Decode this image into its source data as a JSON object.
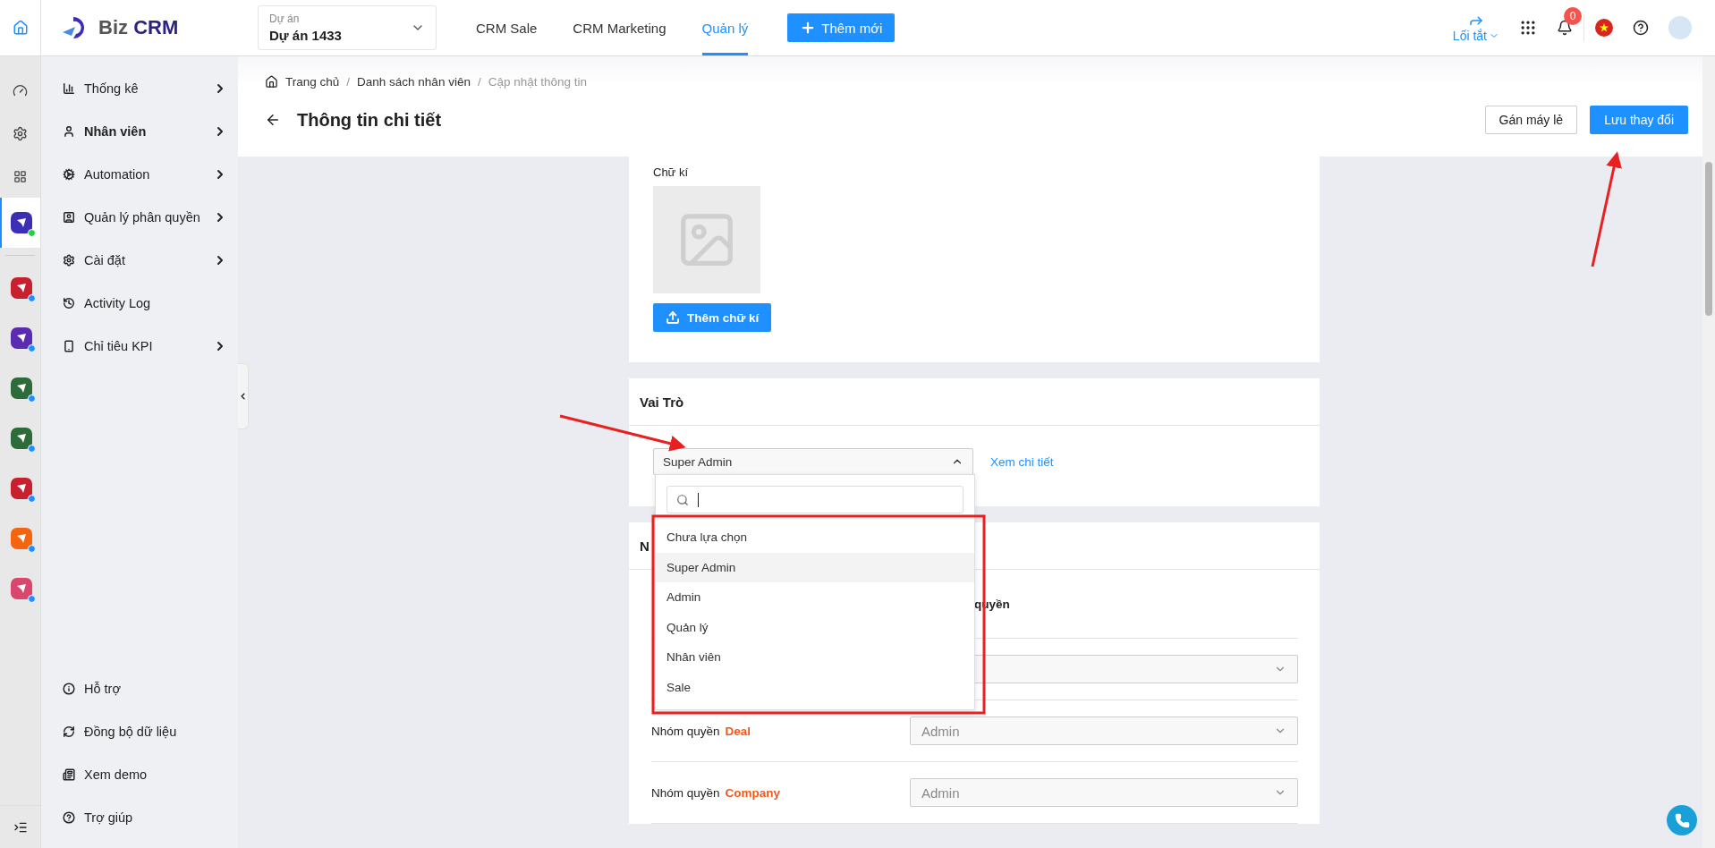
{
  "topbar": {
    "logo": {
      "part_1": "Biz",
      "part_2": "CRM"
    },
    "project": {
      "label": "Dự án",
      "value": "Dự án 1433"
    },
    "nav": [
      {
        "label": "CRM Sale",
        "selected": false
      },
      {
        "label": "CRM Marketing",
        "selected": false
      },
      {
        "label": "Quản lý",
        "selected": true
      }
    ],
    "add_button": "Thêm mới",
    "shortcut": "Lối tắt",
    "notification_count": "0"
  },
  "rail_apps": [
    {
      "color": "#3b2fb5",
      "selected": true
    },
    {
      "color": "#c8202f",
      "selected": false
    },
    {
      "color": "#5b2bb0",
      "selected": false
    },
    {
      "color": "#2e6b3a",
      "selected": false
    },
    {
      "color": "#2e6b3a",
      "selected": false
    },
    {
      "color": "#c8202f",
      "selected": false
    },
    {
      "color": "#f5640f",
      "selected": false
    },
    {
      "color": "#d9466e",
      "selected": false
    }
  ],
  "sidebar": {
    "items": [
      {
        "label": "Thống kê",
        "selected": false,
        "has_submenu": true
      },
      {
        "label": "Nhân viên",
        "selected": true,
        "has_submenu": true
      },
      {
        "label": "Automation",
        "selected": false,
        "has_submenu": true
      },
      {
        "label": "Quản lý phân quyền",
        "selected": false,
        "has_submenu": true
      },
      {
        "label": "Cài đặt",
        "selected": false,
        "has_submenu": true
      },
      {
        "label": "Activity Log",
        "selected": false,
        "has_submenu": false
      },
      {
        "label": "Chỉ tiêu KPI",
        "selected": false,
        "has_submenu": true
      }
    ],
    "footer_items": [
      "Hỗ trợ",
      "Đồng bộ dữ liệu",
      "Xem demo",
      "Trợ giúp"
    ]
  },
  "breadcrumb_separator": "/",
  "breadcrumb": [
    {
      "label": "Trang chủ",
      "current": false
    },
    {
      "label": "Danh sách nhân viên",
      "current": false
    },
    {
      "label": "Cập nhật thông tin",
      "current": true
    }
  ],
  "title": "Thông tin chi tiết",
  "actions": [
    {
      "label": "Gán máy lẻ",
      "kind": "outline"
    },
    {
      "label": "Lưu thay đổi",
      "kind": "primary"
    }
  ],
  "signature": {
    "label": "Chữ kí",
    "button": "Thêm chữ kí"
  },
  "role": {
    "title": "Vai Trò",
    "value": "Super Admin",
    "open": true,
    "link": "Xem chi tiết",
    "options": [
      {
        "label": "Chưa lựa chọn",
        "selected": false
      },
      {
        "label": "Super Admin",
        "selected": true
      },
      {
        "label": "Admin",
        "selected": false
      },
      {
        "label": "Quản lý",
        "selected": false
      },
      {
        "label": "Nhân viên",
        "selected": false
      },
      {
        "label": "Sale",
        "selected": false
      }
    ]
  },
  "permissions": {
    "title": "N",
    "column_2": "quyền",
    "rows": [
      {},
      {
        "label": "Nhóm quyền",
        "module": "Deal",
        "value": "Admin"
      },
      {
        "label": "Nhóm quyền",
        "module": "Company",
        "value": "Admin"
      }
    ]
  }
}
